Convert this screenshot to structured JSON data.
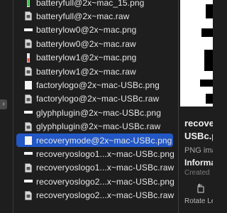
{
  "sidebar": {
    "collapse_glyph": "›"
  },
  "files": [
    {
      "name": "batteryfull@2x~mac_15.png",
      "icon": "battery-thumbnail-icon",
      "selected": false
    },
    {
      "name": "batteryfull@2x~mac.raw",
      "icon": "raw-document-icon",
      "selected": false
    },
    {
      "name": "batterylow0@2x~mac.png",
      "icon": "white-bar-thumbnail-icon",
      "selected": false
    },
    {
      "name": "batterylow0@2x~mac.raw",
      "icon": "raw-document-icon",
      "selected": false
    },
    {
      "name": "batterylow1@2x~mac.png",
      "icon": "battery-thumbnail-icon",
      "selected": false
    },
    {
      "name": "batterylow1@2x~mac.raw",
      "icon": "raw-document-icon",
      "selected": false
    },
    {
      "name": "factorylogo@2x~mac-USBc.png",
      "icon": "white-square-thumbnail-icon",
      "selected": false
    },
    {
      "name": "factorylogo@2x~mac-USBc.raw",
      "icon": "raw-document-icon",
      "selected": false
    },
    {
      "name": "glyphplugin@2x~mac-USBc.png",
      "icon": "white-bar-thumbnail-icon",
      "selected": false
    },
    {
      "name": "glyphplugin@2x~mac-USBc.raw",
      "icon": "raw-document-icon",
      "selected": false
    },
    {
      "name": "recoverymode@2x~mac-USBc.png",
      "icon": "white-square-thumbnail-icon",
      "selected": true
    },
    {
      "name": "recoveryoslogo1...x~mac-USBc.png",
      "icon": "white-bar-thumbnail-icon",
      "selected": false
    },
    {
      "name": "recoveryoslogo1...x~mac-USBc.raw",
      "icon": "raw-document-icon",
      "selected": false
    },
    {
      "name": "recoveryoslogo2...x~mac-USBc.png",
      "icon": "white-bar-thumbnail-icon",
      "selected": false
    },
    {
      "name": "recoveryoslogo2...x~mac-USBc.raw",
      "icon": "raw-document-icon",
      "selected": false
    }
  ],
  "preview": {
    "title_line1": "recover",
    "title_line2": "USBc.p",
    "kind": "PNG ima",
    "info_heading": "Informat",
    "created_label": "Created",
    "rotate_label": "Rotate Le"
  },
  "colors": {
    "selection": "#2257c5",
    "battery_green": "#3bbf4c",
    "battery_red": "#e0584f"
  }
}
